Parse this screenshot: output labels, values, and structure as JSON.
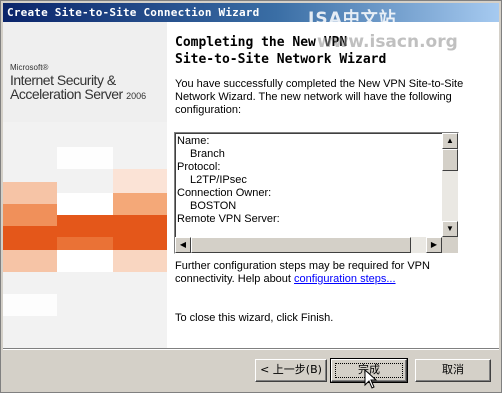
{
  "window": {
    "title": "Create Site-to-Site Connection Wizard",
    "watermark": "ISA中文站",
    "watermark_url": "www.isacn.org"
  },
  "branding": {
    "vendor": "Microsoft®",
    "product_line1": "Internet Security &",
    "product_line2": "Acceleration Server",
    "product_year": "2006"
  },
  "colors": {
    "accent_orange": "#e4571a",
    "accent_orange_light": "#f0905a",
    "title_dark": "#0a246a",
    "title_light": "#a6caf0"
  },
  "page": {
    "heading": "Completing the New VPN\nSite-to-Site Network Wizard",
    "intro": "You have successfully completed the New VPN Site-to-Site Network Wizard. The new network will have the following configuration:",
    "configuration": [
      {
        "text": "Name:",
        "indent": false
      },
      {
        "text": "Branch",
        "indent": true
      },
      {
        "text": "Protocol:",
        "indent": false
      },
      {
        "text": "L2TP/IPsec",
        "indent": true
      },
      {
        "text": "Connection Owner:",
        "indent": false
      },
      {
        "text": "BOSTON",
        "indent": true
      },
      {
        "text": "Remote VPN Server:",
        "indent": false
      }
    ],
    "further_text": "Further configuration steps may be required for VPN connectivity. Help about ",
    "further_link": "configuration steps...",
    "close_note": "To close this wizard, click Finish."
  },
  "scrollbar_icons": {
    "up": "arrow-up-icon",
    "down": "arrow-down-icon",
    "left": "arrow-left-icon",
    "right": "arrow-right-icon"
  },
  "buttons": {
    "back": "< 上一步(B)",
    "finish": "完成",
    "cancel": "取消"
  }
}
